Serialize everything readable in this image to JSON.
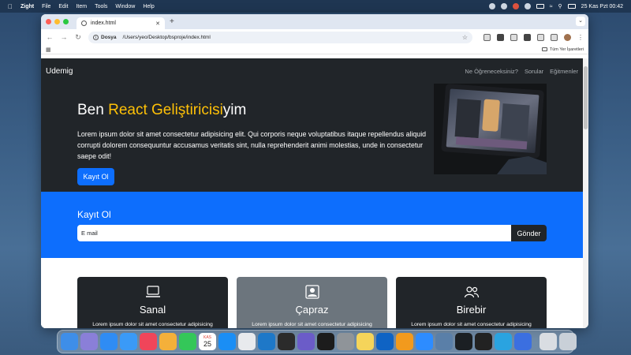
{
  "menubar": {
    "app_name": "Zight",
    "items": [
      "File",
      "Edit",
      "Item",
      "Tools",
      "Window",
      "Help"
    ],
    "clock": "25 Kas Pzt  00:42"
  },
  "browser": {
    "tab_title": "index.html",
    "url_chip": "Dosya",
    "url": "/Users/yeo/Desktop/bsproje/index.html",
    "bookmarks_folder": "Tüm Yer İşaretleri"
  },
  "site": {
    "brand": "Udemig",
    "nav": [
      "Ne Öğreneceksiniz?",
      "Sorular",
      "Eğitmenler"
    ],
    "hero": {
      "title_prefix": "Ben ",
      "title_accent": "React Geliştiricisi",
      "title_suffix": "yim",
      "text": "Lorem ipsum dolor sit amet consectetur adipisicing elit. Qui corporis neque voluptatibus itaque repellendus aliquid corrupti dolorem consequuntur accusamus veritatis sint, nulla reprehenderit animi molestias, unde in consectetur saepe odit!",
      "button": "Kayıt Ol"
    },
    "signup": {
      "title": "Kayıt Ol",
      "placeholder": "E mail",
      "button": "Gönder"
    },
    "cards": [
      {
        "title": "Sanal",
        "icon": "laptop-icon",
        "text": "Lorem ipsum dolor sit amet consectetur adipisicing"
      },
      {
        "title": "Çapraz",
        "icon": "person-badge-icon",
        "text": "Lorem ipsum dolor sit amet consectetur adipisicing"
      },
      {
        "title": "Birebir",
        "icon": "people-icon",
        "text": "Lorem ipsum dolor sit amet consectetur adipisicing"
      }
    ]
  },
  "colors": {
    "dark": "#212529",
    "primary": "#0d6efd",
    "accent": "#ffc107",
    "secondary": "#6c757d"
  },
  "dock": {
    "calendar_month": "KAS",
    "calendar_day": "25"
  }
}
